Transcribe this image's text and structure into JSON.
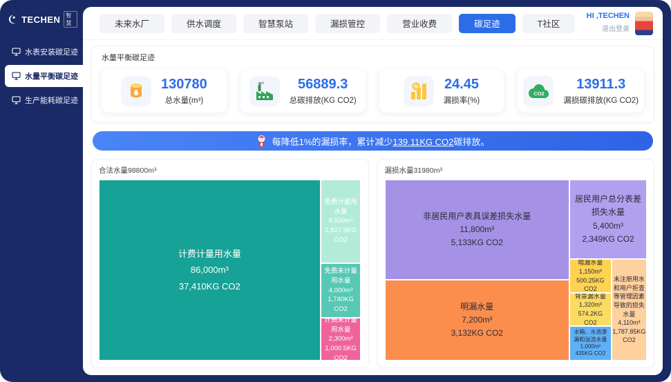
{
  "app": {
    "brand": "TECHEN",
    "brand_badge": "智慧",
    "greeting": "HI ,TECHEN",
    "logout_label": "退出登录"
  },
  "nav_tabs": [
    {
      "label": "未来水厂",
      "active": false
    },
    {
      "label": "供水调度",
      "active": false
    },
    {
      "label": "智慧泵站",
      "active": false
    },
    {
      "label": "漏损管控",
      "active": false
    },
    {
      "label": "营业收费",
      "active": false
    },
    {
      "label": "碳足迹",
      "active": true
    },
    {
      "label": "T社区",
      "active": false
    }
  ],
  "sidebar": {
    "items": [
      {
        "label": "水表安装碳足迹",
        "active": false
      },
      {
        "label": "水量平衡碳足迹",
        "active": true
      },
      {
        "label": "生产能耗碳足迹",
        "active": false
      }
    ]
  },
  "section": {
    "title": "水量平衡碳足迹"
  },
  "kpis": [
    {
      "value": "130780",
      "label": "总水量(m³)",
      "icon": "water-tank-icon"
    },
    {
      "value": "56889.3",
      "label": "总碳排放(KG CO2)",
      "icon": "factory-icon"
    },
    {
      "value": "24.45",
      "label": "漏损率(%)",
      "icon": "percent-icon"
    },
    {
      "value": "13911.3",
      "label": "漏损碳排放(KG CO2)",
      "icon": "co2-cloud-icon"
    }
  ],
  "banner": {
    "prefix": "每降低1%的漏损率，累计减少",
    "highlight": "139.11KG CO2",
    "suffix": "碳排放。"
  },
  "colors": {
    "accent_blue": "#2b6de8",
    "frame_navy": "#1a2a66",
    "banner_blue": "#2e63e6"
  },
  "chart_data": [
    {
      "type": "treemap",
      "title": "合法水量98800m³",
      "total": 98800,
      "unit": "m³",
      "blocks": [
        {
          "label": "计费计量用水量",
          "value": 86000,
          "volume": "86,000m³",
          "co2_value": 37410,
          "co2": "37,410KG CO2",
          "color": "#16a296"
        },
        {
          "label": "免费计量用水量",
          "value": 6500,
          "volume": "6,500m³",
          "co2_value": 2827.5,
          "co2": "2,827.5KG CO2",
          "color": "#b2ecd9"
        },
        {
          "label": "免费未计量用水量",
          "value": 4000,
          "volume": "4,000m³",
          "co2_value": 1740,
          "co2": "1,740KG CO2",
          "color": "#57c8b3"
        },
        {
          "label": "计费未计量用水量",
          "value": 2300,
          "volume": "2,300m³",
          "co2_value": 1000.5,
          "co2": "1,000.5KG CO2",
          "color": "#ef639d"
        }
      ]
    },
    {
      "type": "treemap",
      "title": "漏损水量31980m³",
      "total": 31980,
      "unit": "m³",
      "blocks": [
        {
          "label": "非居民用户表具误差损失水量",
          "value": 11800,
          "volume": "11,800m³",
          "co2_value": 5133,
          "co2": "5,133KG CO2",
          "color": "#a592e6"
        },
        {
          "label": "居民用户总分表差损失水量",
          "value": 5400,
          "volume": "5,400m³",
          "co2_value": 2349,
          "co2": "2,349KG CO2",
          "color": "#b1a0ee"
        },
        {
          "label": "明漏水量",
          "value": 7200,
          "volume": "7,200m³",
          "co2_value": 3132,
          "co2": "3,132KG CO2",
          "color": "#fb8e4d"
        },
        {
          "label": "暗漏水量",
          "value": 1150,
          "volume": "1,150m³",
          "co2_value": 500.25,
          "co2": "500.25KG CO2",
          "color": "#ffd34f"
        },
        {
          "label": "背景漏水量",
          "value": 1320,
          "volume": "1,320m³",
          "co2_value": 574.2,
          "co2": "574.2KG CO2",
          "color": "#fbdc62"
        },
        {
          "label": "水箱、水池渗漏和溢流水量",
          "value": 1000,
          "volume": "1,000m³",
          "co2_value": 435,
          "co2": "435KG CO2",
          "color": "#5db0f6"
        },
        {
          "label": "未注册用水和用户拒查等管理因素导致的损失水量",
          "value": 4110,
          "volume": "4,110m³",
          "co2_value": 1787.85,
          "co2": "1,787.85KG CO2",
          "color": "#ffd19e"
        }
      ]
    }
  ]
}
